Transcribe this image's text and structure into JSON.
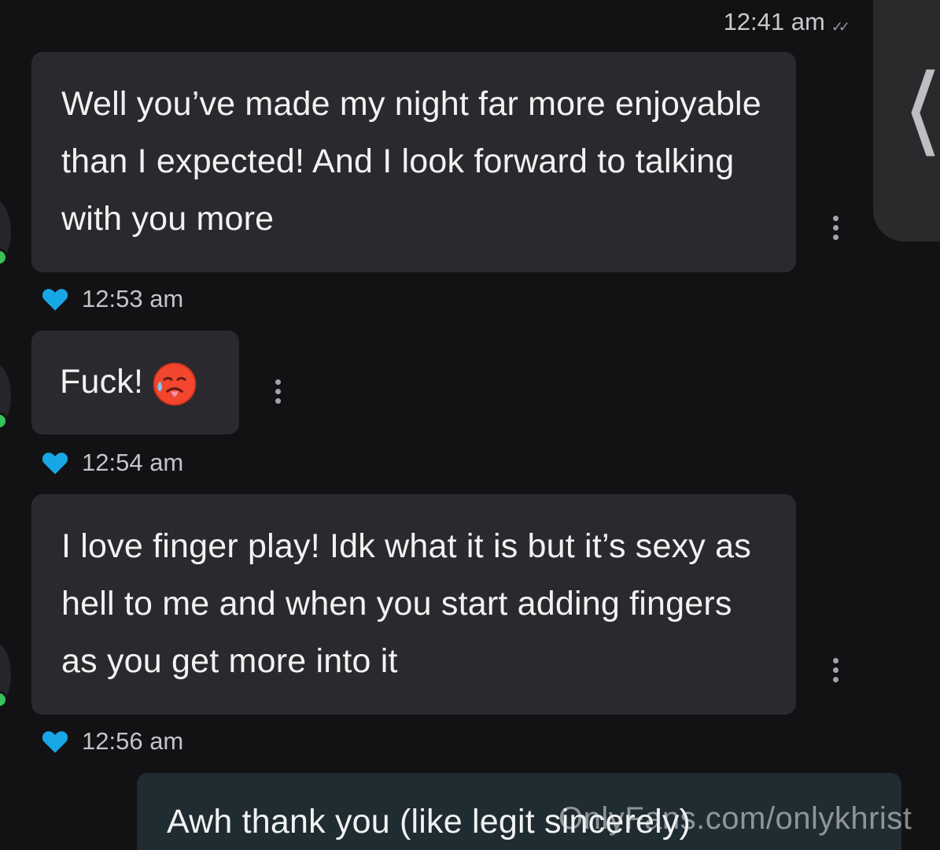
{
  "header": {
    "sent_time": "12:41 am"
  },
  "messages": [
    {
      "id": "m1",
      "direction": "incoming",
      "text": "Well you’ve made my night far more enjoyable than I expected! And I look forward to talking with you more",
      "time": "12:53 am",
      "liked": true
    },
    {
      "id": "m2",
      "direction": "incoming",
      "text": "Fuck!",
      "emoji": "hot-face-drooling-emoji",
      "time": "12:54 am",
      "liked": true
    },
    {
      "id": "m3",
      "direction": "incoming",
      "text": "I love finger play! Idk what it is but it’s sexy as hell to me and when you start adding fingers as you get more into it",
      "time": "12:56 am",
      "liked": true
    },
    {
      "id": "m4",
      "direction": "outgoing",
      "text": "Awh thank you (like legit sincerely)"
    }
  ],
  "watermark": "OnlyFans.com/onlykhrist",
  "colors": {
    "background": "#121214",
    "incoming_bubble": "#2a2a2e",
    "outgoing_bubble": "#1f2c32",
    "like_heart": "#17a7e6",
    "online_dot": "#39c15a"
  },
  "icons": [
    "double-check-icon",
    "chevron-left-icon",
    "more-options-icon",
    "heart-icon",
    "online-status-dot"
  ]
}
